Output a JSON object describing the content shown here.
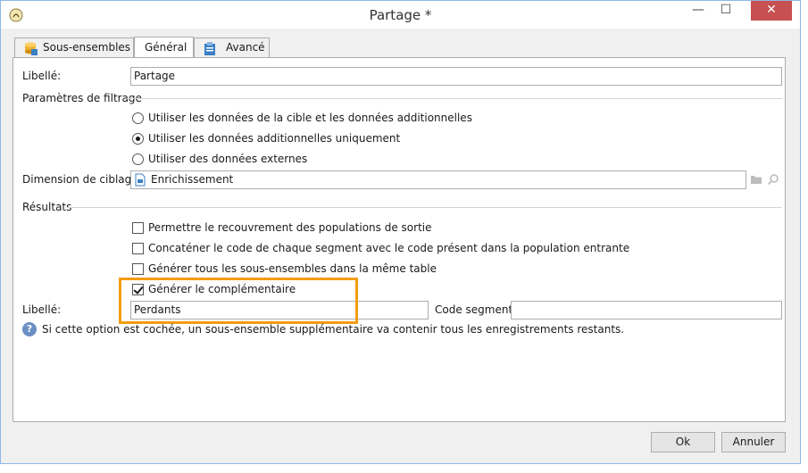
{
  "window": {
    "title": "Partage *",
    "minimize_glyph": "—",
    "maximize_glyph": "☐",
    "close_glyph": "✕"
  },
  "tabs": [
    {
      "label": "Sous-ensembles",
      "icon": "database-icon"
    },
    {
      "label": "Général",
      "icon": ""
    },
    {
      "label": "Avancé",
      "icon": "clipboard-icon"
    }
  ],
  "general": {
    "libelle_label": "Libellé:",
    "libelle_value": "Partage",
    "filter_section": "Paramètres de filtrage",
    "radio_options": [
      {
        "label": "Utiliser les données de la cible et les données additionnelles",
        "checked": false
      },
      {
        "label": "Utiliser les données additionnelles uniquement",
        "checked": true
      },
      {
        "label": "Utiliser des données externes",
        "checked": false
      }
    ],
    "targeting_label": "Dimension de ciblage:",
    "targeting_value": "Enrichissement",
    "results_section": "Résultats",
    "checkboxes": [
      {
        "label": "Permettre le recouvrement des populations de sortie",
        "checked": false
      },
      {
        "label": "Concaténer le code de chaque segment avec le code présent dans la population entrante",
        "checked": false
      },
      {
        "label": "Générer tous les sous-ensembles dans la même table",
        "checked": false
      },
      {
        "label": "Générer le complémentaire",
        "checked": true
      }
    ],
    "complement_label": "Libellé:",
    "complement_value": "Perdants",
    "segment_code_label": "Code segment:",
    "segment_code_value": "",
    "help_text": "Si cette option est cochée, un sous-ensemble supplémentaire va contenir tous les enregistrements restants."
  },
  "footer": {
    "ok_label": "Ok",
    "cancel_label": "Annuler"
  },
  "colors": {
    "highlight": "#f39c12",
    "close_button": "#c75050",
    "window_border": "#8fb7e8"
  }
}
